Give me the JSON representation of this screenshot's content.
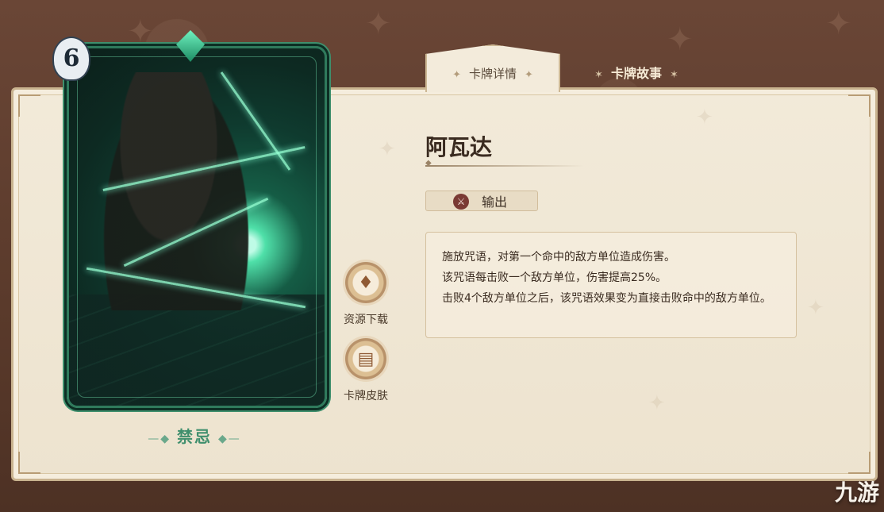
{
  "tabs": {
    "details_label": "卡牌详情",
    "story_label": "卡牌故事"
  },
  "card": {
    "cost": "6",
    "type_label": "禁忌"
  },
  "actions": {
    "download_label": "资源下载",
    "skin_label": "卡牌皮肤"
  },
  "card_info": {
    "name": "阿瓦达",
    "role_label": "输出",
    "description": [
      "施放咒语，对第一个命中的敌方单位造成伤害。",
      "该咒语每击败一个敌方单位，伤害提高25%。",
      "击败4个敌方单位之后，该咒语效果变为直接击败命中的敌方单位。"
    ]
  },
  "watermark": "九游",
  "colors": {
    "background": "#5c3d2e",
    "panel": "#f2ead9",
    "card_accent": "#2f7a5c",
    "role_icon": "#7a3a34"
  },
  "icons": {
    "download": "money-bag-icon",
    "skin": "cards-icon",
    "role": "damage-icon",
    "tab_sparkle": "sparkle-icon"
  }
}
